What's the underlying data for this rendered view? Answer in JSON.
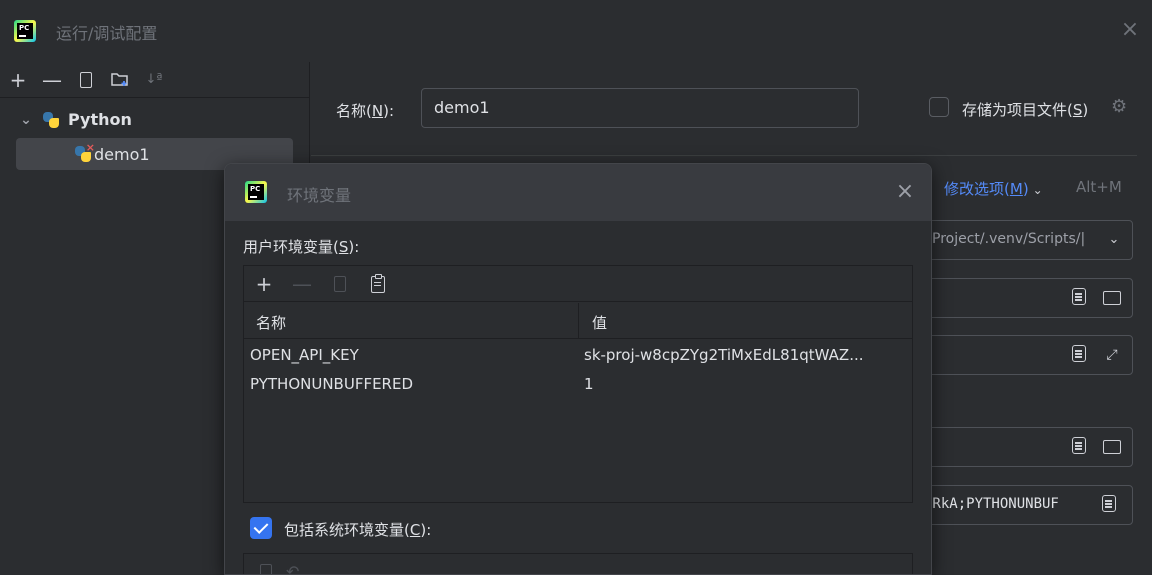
{
  "main_dialog": {
    "title": "运行/调试配置",
    "close_icon": "×"
  },
  "left_panel": {
    "toolbar": {
      "add": "+",
      "remove": "—",
      "sort": "↓ª"
    },
    "tree": {
      "group": "Python",
      "item": "demo1"
    }
  },
  "right_panel": {
    "name_label_prefix": "名称(",
    "name_label_key": "N",
    "name_label_suffix": "):",
    "name_value": "demo1",
    "store_label_prefix": "存储为项目文件(",
    "store_label_key": "S",
    "store_label_suffix": ")",
    "modify_options_prefix": "修改选项(",
    "modify_options_key": "M",
    "modify_options_suffix": ")",
    "modify_shortcut": "Alt+M",
    "interpreter_partial": "Project/.venv/Scripts/|",
    "env_field_partial": "tRkA;PYTHONUNBUF"
  },
  "env_dialog": {
    "title": "环境变量",
    "close_icon": "×",
    "user_env_prefix": "用户环境变量(",
    "user_env_key": "S",
    "user_env_suffix": "):",
    "toolbar": {
      "add": "+",
      "remove": "—"
    },
    "columns": [
      "名称",
      "值"
    ],
    "rows": [
      {
        "name": "OPEN_API_KEY",
        "value": "sk-proj-w8cpZYg2TiMxEdL81qtWAZ..."
      },
      {
        "name": "PYTHONUNBUFFERED",
        "value": "1"
      }
    ],
    "include_system_prefix": "包括系统环境变量(",
    "include_system_key": "C",
    "include_system_suffix": "):",
    "include_system_checked": true
  },
  "colors": {
    "background": "#2b2d30",
    "accent_link": "#548af7",
    "checkbox_accent": "#3574f0",
    "muted": "#6f737a"
  }
}
